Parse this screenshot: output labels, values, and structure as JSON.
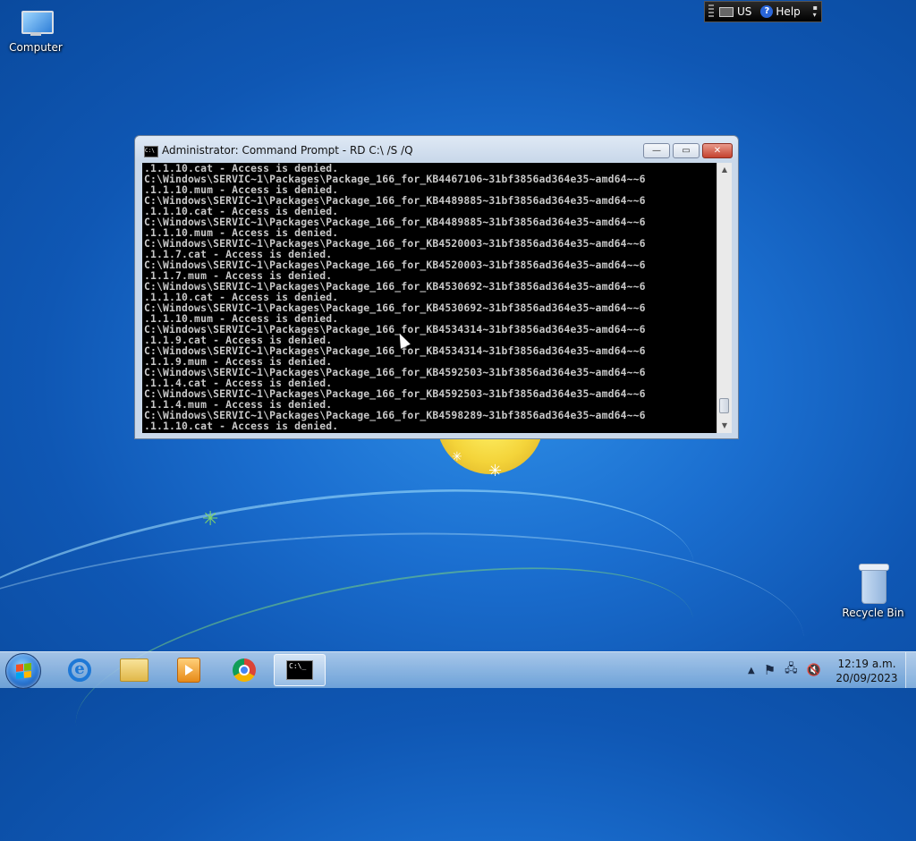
{
  "desktop": {
    "icons": [
      {
        "label": "Computer",
        "icon": "computer-icon"
      },
      {
        "label": "Recycle Bin",
        "icon": "recycle-bin-icon"
      }
    ]
  },
  "language_bar": {
    "language": "US",
    "help_label": "Help"
  },
  "window": {
    "title": "Administrator:  Command Prompt - RD  C:\\ /S /Q",
    "controls": {
      "minimize": "—",
      "maximize": "▭",
      "close": "✕"
    },
    "console_lines": [
      ".1.1.10.cat - Access is denied.",
      "C:\\Windows\\SERVIC~1\\Packages\\Package_166_for_KB4467106~31bf3856ad364e35~amd64~~6",
      ".1.1.10.mum - Access is denied.",
      "C:\\Windows\\SERVIC~1\\Packages\\Package_166_for_KB4489885~31bf3856ad364e35~amd64~~6",
      ".1.1.10.cat - Access is denied.",
      "C:\\Windows\\SERVIC~1\\Packages\\Package_166_for_KB4489885~31bf3856ad364e35~amd64~~6",
      ".1.1.10.mum - Access is denied.",
      "C:\\Windows\\SERVIC~1\\Packages\\Package_166_for_KB4520003~31bf3856ad364e35~amd64~~6",
      ".1.1.7.cat - Access is denied.",
      "C:\\Windows\\SERVIC~1\\Packages\\Package_166_for_KB4520003~31bf3856ad364e35~amd64~~6",
      ".1.1.7.mum - Access is denied.",
      "C:\\Windows\\SERVIC~1\\Packages\\Package_166_for_KB4530692~31bf3856ad364e35~amd64~~6",
      ".1.1.10.cat - Access is denied.",
      "C:\\Windows\\SERVIC~1\\Packages\\Package_166_for_KB4530692~31bf3856ad364e35~amd64~~6",
      ".1.1.10.mum - Access is denied.",
      "C:\\Windows\\SERVIC~1\\Packages\\Package_166_for_KB4534314~31bf3856ad364e35~amd64~~6",
      ".1.1.9.cat - Access is denied.",
      "C:\\Windows\\SERVIC~1\\Packages\\Package_166_for_KB4534314~31bf3856ad364e35~amd64~~6",
      ".1.1.9.mum - Access is denied.",
      "C:\\Windows\\SERVIC~1\\Packages\\Package_166_for_KB4592503~31bf3856ad364e35~amd64~~6",
      ".1.1.4.cat - Access is denied.",
      "C:\\Windows\\SERVIC~1\\Packages\\Package_166_for_KB4592503~31bf3856ad364e35~amd64~~6",
      ".1.1.4.mum - Access is denied.",
      "C:\\Windows\\SERVIC~1\\Packages\\Package_166_for_KB4598289~31bf3856ad364e35~amd64~~6",
      ".1.1.10.cat - Access is denied."
    ]
  },
  "taskbar": {
    "pinned": [
      {
        "name": "internet-explorer",
        "icon": "internet-explorer-icon"
      },
      {
        "name": "windows-explorer",
        "icon": "folder-icon"
      },
      {
        "name": "media-player",
        "icon": "media-player-icon"
      },
      {
        "name": "chrome",
        "icon": "chrome-icon"
      },
      {
        "name": "command-prompt",
        "icon": "command-prompt-icon",
        "active": true
      }
    ],
    "cmd_icon_text": "C:\\_",
    "tray": {
      "show_hidden": "▲",
      "flag": "⚑",
      "network": "🖧",
      "volume": "🔇"
    },
    "clock": {
      "time": "12:19 a.m.",
      "date": "20/09/2023"
    }
  },
  "colors": {
    "desktop_blue": "#1b6fd0",
    "console_bg": "#000000",
    "console_text": "#c8c8c8",
    "close_red": "#c4422e"
  }
}
